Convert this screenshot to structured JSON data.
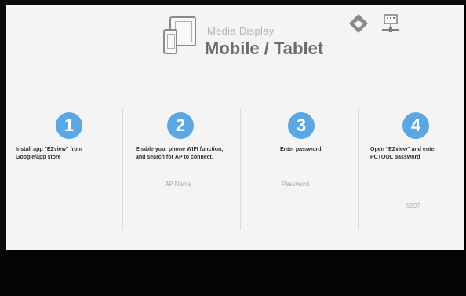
{
  "header": {
    "subtitle": "Media Display",
    "title": "Mobile / Tablet",
    "icons": [
      "tablet-phone-icon",
      "network-diamond-icon",
      "lan-computer-icon"
    ]
  },
  "steps": [
    {
      "number": "1",
      "text": "Install app \"EZview\" from Google/app store"
    },
    {
      "number": "2",
      "text": "Enable your phone WIFI function, and search for AP to connect.",
      "field_label": "AP Name"
    },
    {
      "number": "3",
      "text": "Enter password",
      "field_label": "Password"
    },
    {
      "number": "4",
      "text": "Open \"EZview\" and enter PCTOOL password",
      "value": "5997"
    }
  ],
  "colors": {
    "accent": "#5aa7e6",
    "background": "#f4f4f4",
    "frame": "#050505"
  }
}
